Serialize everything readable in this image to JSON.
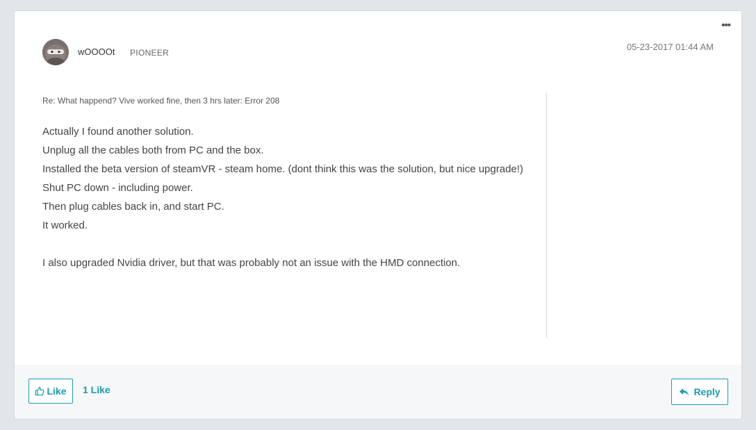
{
  "post": {
    "options_icon": "ellipsis-icon",
    "author": {
      "name": "wOOOOt",
      "rank": "PIONEER",
      "avatar_icon": "avatar"
    },
    "date": "05-23-2017",
    "time": "01:44 AM",
    "subject": "Re: What happend? Vive worked fine, then 3 hrs later: Error 208",
    "body_lines": [
      "Actually I found another solution.",
      "Unplug all the cables both from PC and the box.",
      "Installed the beta version of steamVR - steam home. (dont think this was the solution, but nice upgrade!)",
      "Shut PC down - including power.",
      "Then plug cables back in, and start PC.",
      "It worked.",
      "",
      "I also upgraded Nvidia driver, but that was probably not an issue with the HMD connection."
    ]
  },
  "footer": {
    "like_label": "Like",
    "like_icon": "thumbs-up-icon",
    "like_count": "1 Like",
    "reply_label": "Reply",
    "reply_icon": "reply-arrow-icon"
  },
  "colors": {
    "accent": "#1a9cb0",
    "page_bg": "#e3e6e9",
    "footer_bg": "#f5f7f9"
  }
}
